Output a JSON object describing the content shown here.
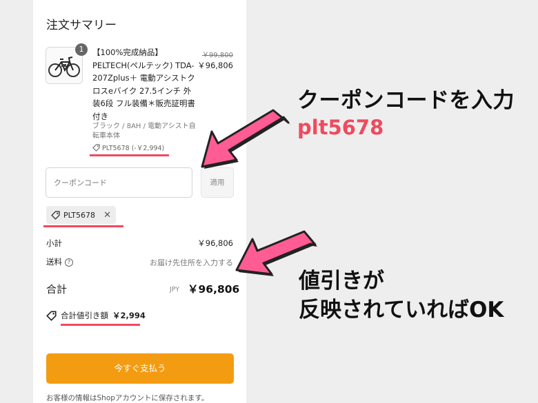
{
  "summary": {
    "title": "注文サマリー",
    "product": {
      "quantity": "1",
      "name": "【100%完成納品】PELTECH(ペルテック) TDA-207Zplus＋ 電動アシストクロスeバイク 27.5インチ 外装6段 フル装備＊販売証明書付き",
      "variant": "ブラック / 8AH / 電動アシスト自転車本体",
      "discount_line": "PLT5678 (-￥2,994)",
      "original_price": "￥99,800",
      "price": "￥96,806"
    },
    "coupon": {
      "placeholder": "クーポンコード",
      "value": "",
      "apply_label": "適用",
      "applied_code": "PLT5678",
      "remove_icon": "close-icon"
    },
    "subtotal": {
      "label": "小計",
      "value": "￥96,806"
    },
    "shipping": {
      "label": "送料",
      "value": "お届け先住所を入力する",
      "info_icon": "?"
    },
    "total": {
      "label": "合計",
      "currency": "JPY",
      "value": "￥96,806"
    },
    "savings": {
      "label": "合計値引き額",
      "value": "￥2,994"
    },
    "pay_button": "今すぐ支払う",
    "footnote": "お客様の情報はShopアカウントに保存されます。"
  },
  "annotations": {
    "coupon_instruction": "クーポンコードを入力",
    "coupon_code": "plt5678",
    "discount_instruction_line1": "値引きが",
    "discount_instruction_line2": "反映されていればOK"
  },
  "colors": {
    "accent_red": "#ef4a5e",
    "arrow_pink": "#ff5c93",
    "pay_orange": "#f39c12"
  }
}
